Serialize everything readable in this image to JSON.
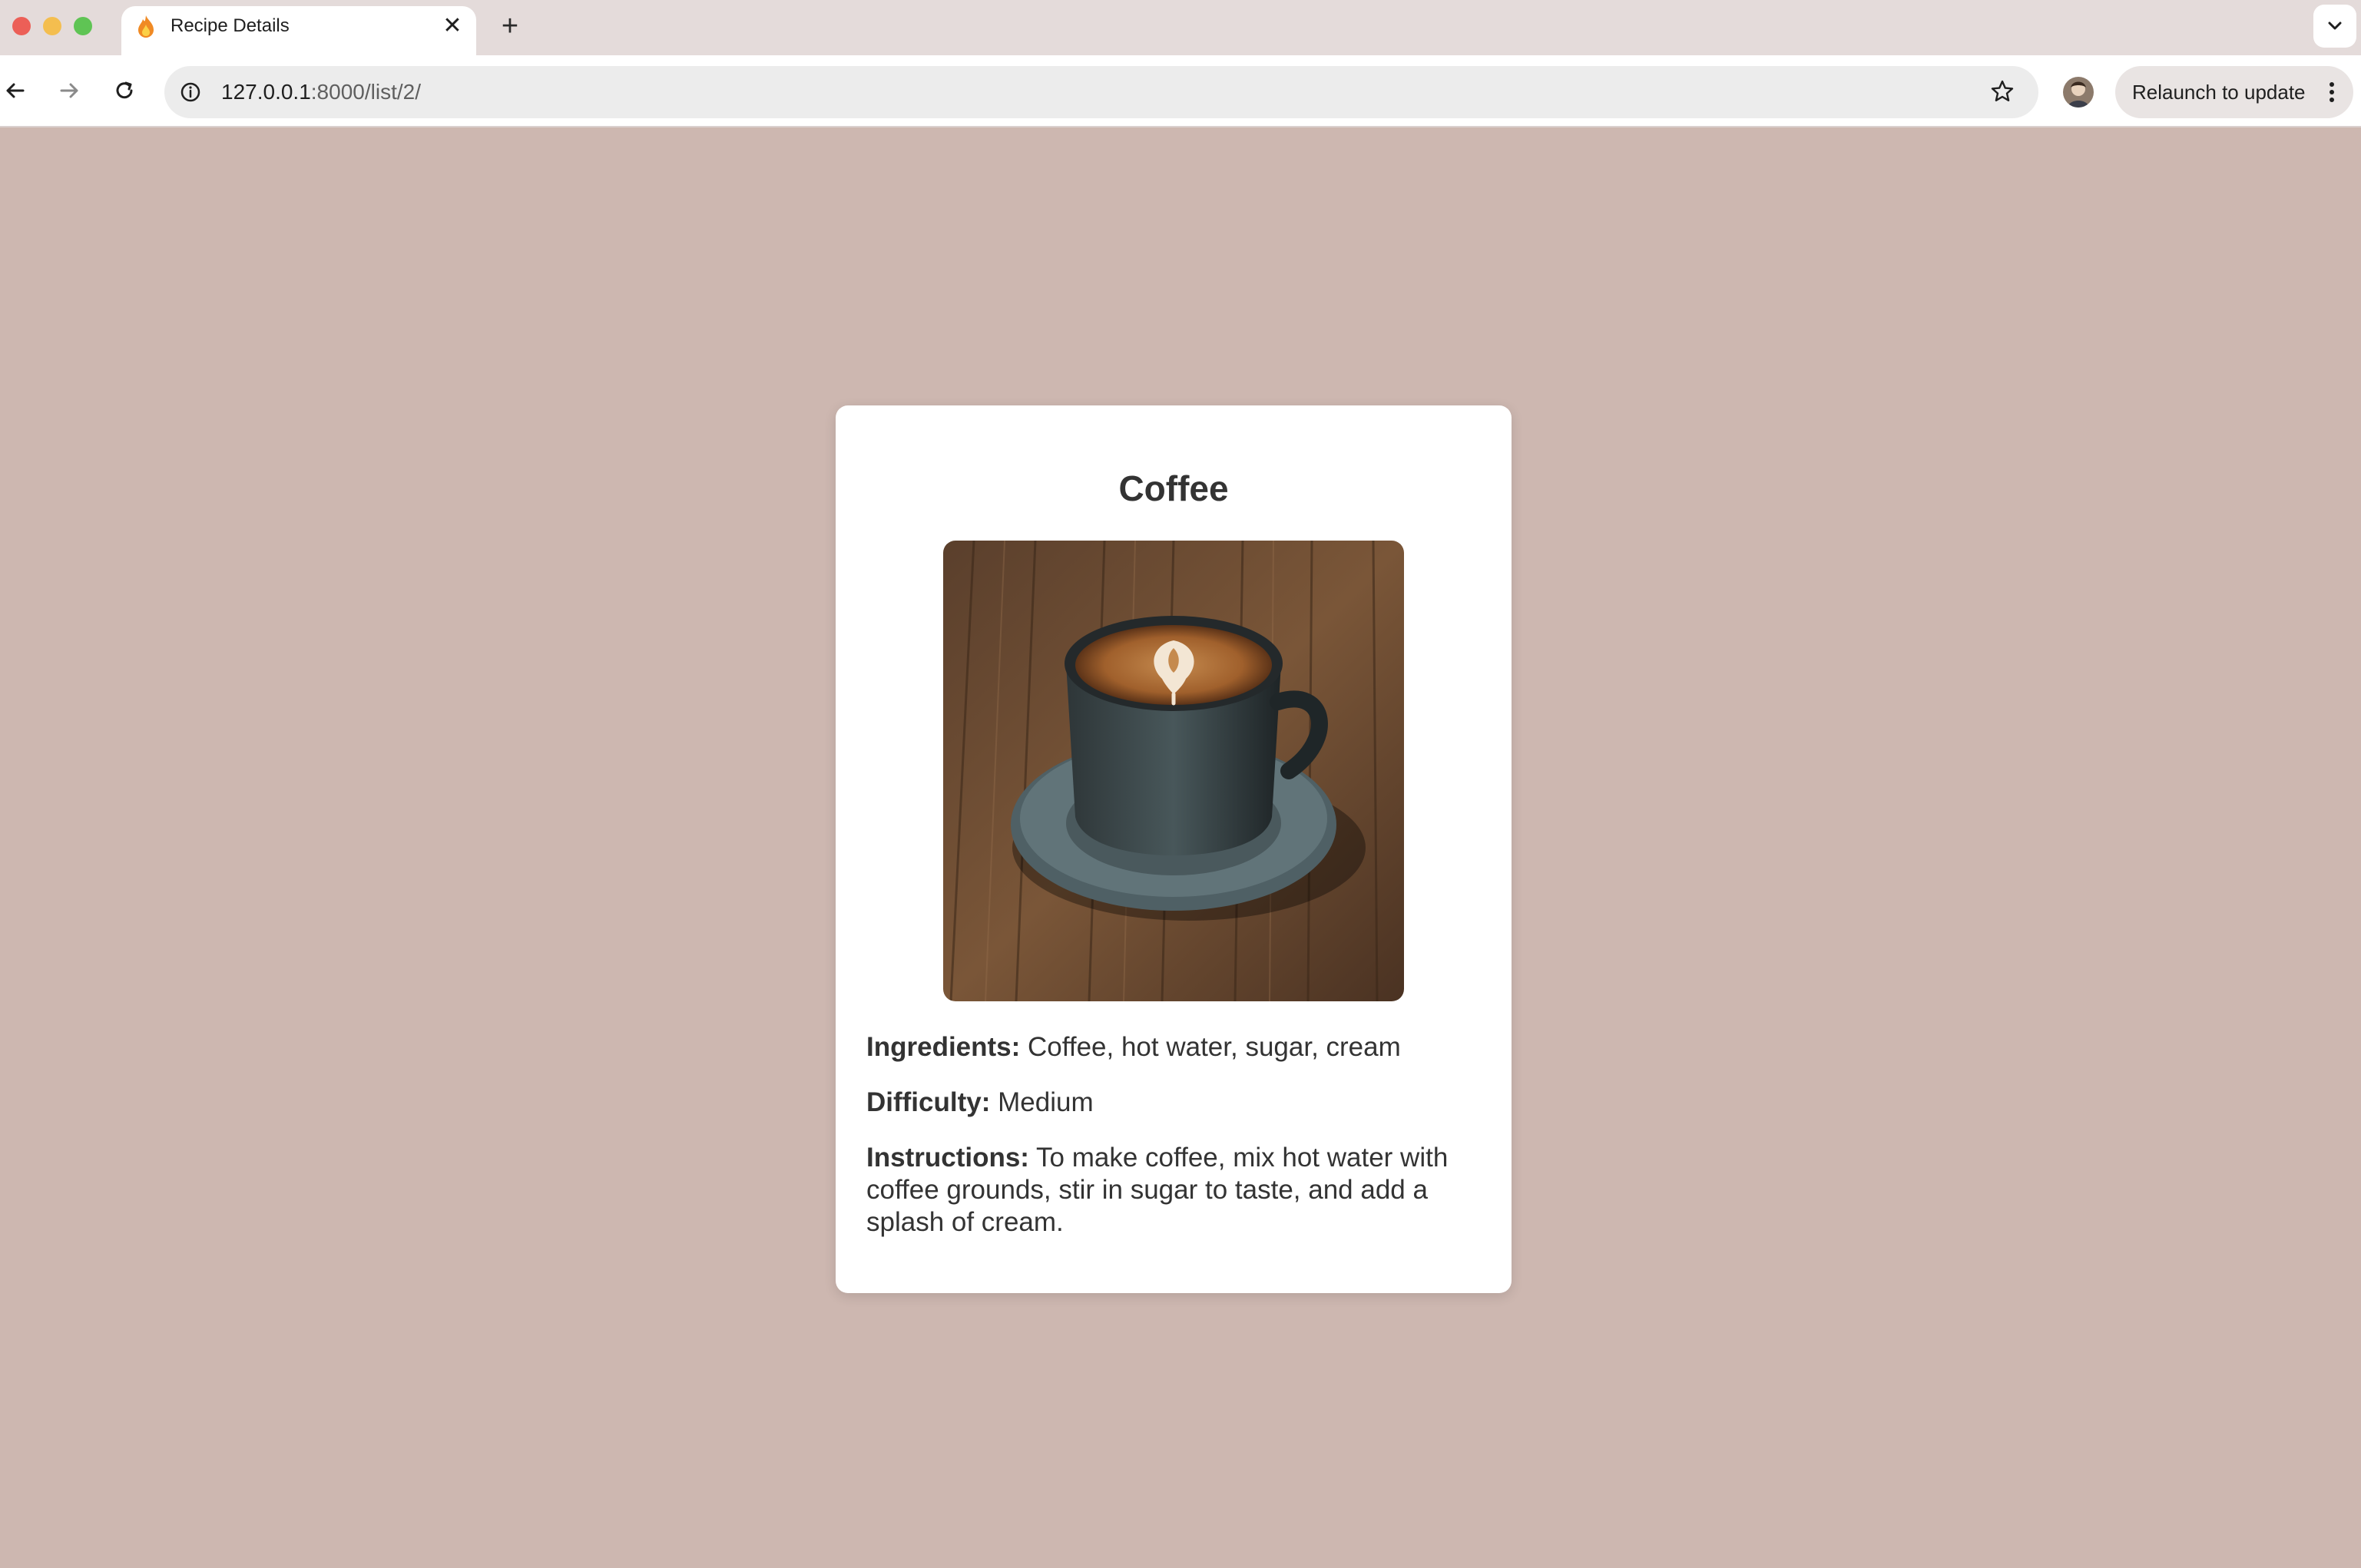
{
  "browser": {
    "tab_title": "Recipe Details",
    "url_host": "127.0.0.1",
    "url_path": ":8000/list/2/",
    "relaunch_label": "Relaunch to update",
    "tab_close_glyph": "✕",
    "new_tab_glyph": "+"
  },
  "recipe": {
    "title": "Coffee",
    "ingredients_label": "Ingredients:",
    "ingredients": "Coffee, hot water, sugar, cream",
    "difficulty_label": "Difficulty:",
    "difficulty": "Medium",
    "instructions_label": "Instructions:",
    "instructions": "To make coffee, mix hot water with coffee grounds, stir in sugar to taste, and add a splash of cream."
  },
  "icons": {
    "favicon": "flame-icon",
    "back": "back-arrow-icon",
    "forward": "forward-arrow-icon",
    "reload": "reload-icon",
    "site_info": "info-icon",
    "bookmark": "star-icon",
    "menu": "kebab-menu-icon",
    "tab_search": "chevron-down-icon",
    "image": "coffee-cup-photo"
  },
  "colors": {
    "page_background": "#cdb7b0",
    "card_background": "#ffffff",
    "text": "#333333",
    "tabstrip": "#e4dbda"
  }
}
